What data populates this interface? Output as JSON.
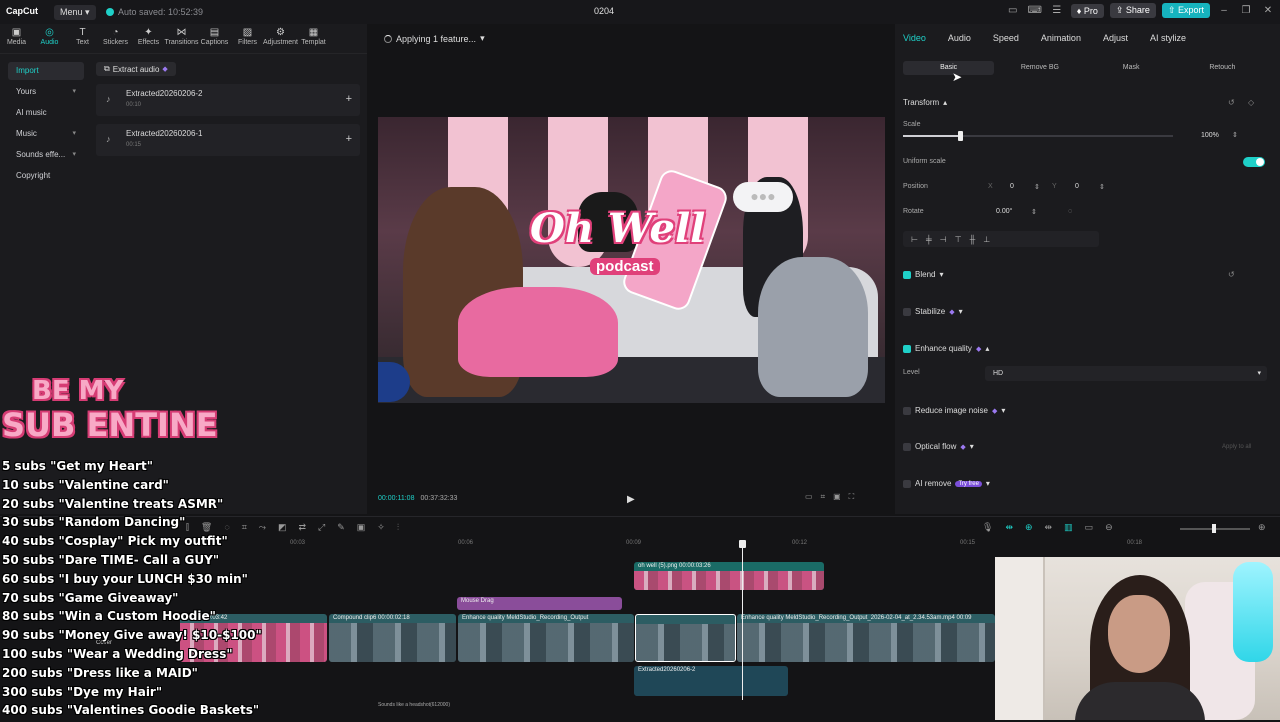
{
  "titlebar": {
    "app_name": "CapCut",
    "menu_label": "Menu",
    "autosave": "Auto saved: 10:52:39",
    "project_title": "0204",
    "pro_label": "Pro",
    "share_label": "Share",
    "export_label": "Export"
  },
  "toolbar": {
    "tools": [
      "Media",
      "Audio",
      "Text",
      "Stickers",
      "Effects",
      "Transitions",
      "Captions",
      "Filters",
      "Adjustment",
      "Templat"
    ]
  },
  "sidebar": {
    "items": [
      {
        "label": "Import"
      },
      {
        "label": "Yours"
      },
      {
        "label": "AI music"
      },
      {
        "label": "Music"
      },
      {
        "label": "Sounds effe..."
      },
      {
        "label": "Copyright"
      }
    ]
  },
  "media": {
    "extract_label": "Extract audio",
    "items": [
      {
        "name": "Extracted20260206-2",
        "duration": "00:10"
      },
      {
        "name": "Extracted20260206-1",
        "duration": "00:15"
      }
    ]
  },
  "player": {
    "status": "Applying 1 feature...",
    "current_time": "00:00:11:08",
    "total_time": "00:37:32:33",
    "video_title": "Oh Well",
    "video_subtitle": "podcast"
  },
  "inspector": {
    "tabs": [
      "Video",
      "Audio",
      "Speed",
      "Animation",
      "Adjust",
      "AI stylize"
    ],
    "subtabs": [
      "Basic",
      "Remove BG",
      "Mask",
      "Retouch"
    ],
    "transform_label": "Transform",
    "scale_label": "Scale",
    "scale_value": "100%",
    "scale_level": 0.21,
    "uniform_scale_label": "Uniform scale",
    "position_label": "Position",
    "pos_x_label": "X",
    "pos_x": "0",
    "pos_y_label": "Y",
    "pos_y": "0",
    "rotate_label": "Rotate",
    "rotate_value": "0.00°",
    "blend_label": "Blend",
    "stabilize_label": "Stabilize",
    "enhance_label": "Enhance quality",
    "level_label": "Level",
    "level_value": "HD",
    "reduce_noise_label": "Reduce image noise",
    "optical_flow_label": "Optical flow",
    "apply_all": "Apply to all",
    "ai_remove_label": "AI remove",
    "try_free": "Try free"
  },
  "timeline": {
    "ruler": [
      "00:03",
      "00:06",
      "00:09",
      "00:12",
      "00:15",
      "00:18"
    ],
    "clips": {
      "overlay": "oh well (5).png  00:00:03:26",
      "mouse_drag": "Mouse Drag",
      "compound": "Compound clip6  00:00:02:18",
      "enhance1": "Enhance quality  MeldStudio_Recording_Output",
      "enhance2": "Enhance quality  MeldStudio_Recording_Output_2026-02-04_at_2.34.53am.mp4  00:09",
      "main_time": "00:03:42",
      "audio": "Extracted20260206-2",
      "cover": "Cover",
      "sounds": "Sounds like a headshot(612000)"
    }
  },
  "overlay": {
    "heading_line1": "BE MY",
    "heading_line2": "SUB ENTINE",
    "goals": [
      "5 subs \"Get my Heart\"",
      "10 subs \"Valentine card\"",
      "20 subs \"Valentine treats ASMR\"",
      "30 subs \"Random Dancing\"",
      "40 subs \"Cosplay\" Pick my outfit\"",
      "50 subs \"Dare TIME- Call a GUY\"",
      "60 subs \"I buy your LUNCH $30 min\"",
      "70 subs \"Game Giveaway\"",
      "80 subs \"Win a Custom Hoodie\"",
      "90 subs \"Money Give away! $10-$100\"",
      "100 subs \"Wear a Wedding Dress\"",
      "200 subs \"Dress like a MAID\"",
      "300 subs \"Dye my Hair\"",
      "400 subs \"Valentines Goodie Baskets\""
    ]
  },
  "colors": {
    "accent": "#1fd0c8",
    "pink": "#e0407a",
    "purple": "#9b79f0"
  }
}
